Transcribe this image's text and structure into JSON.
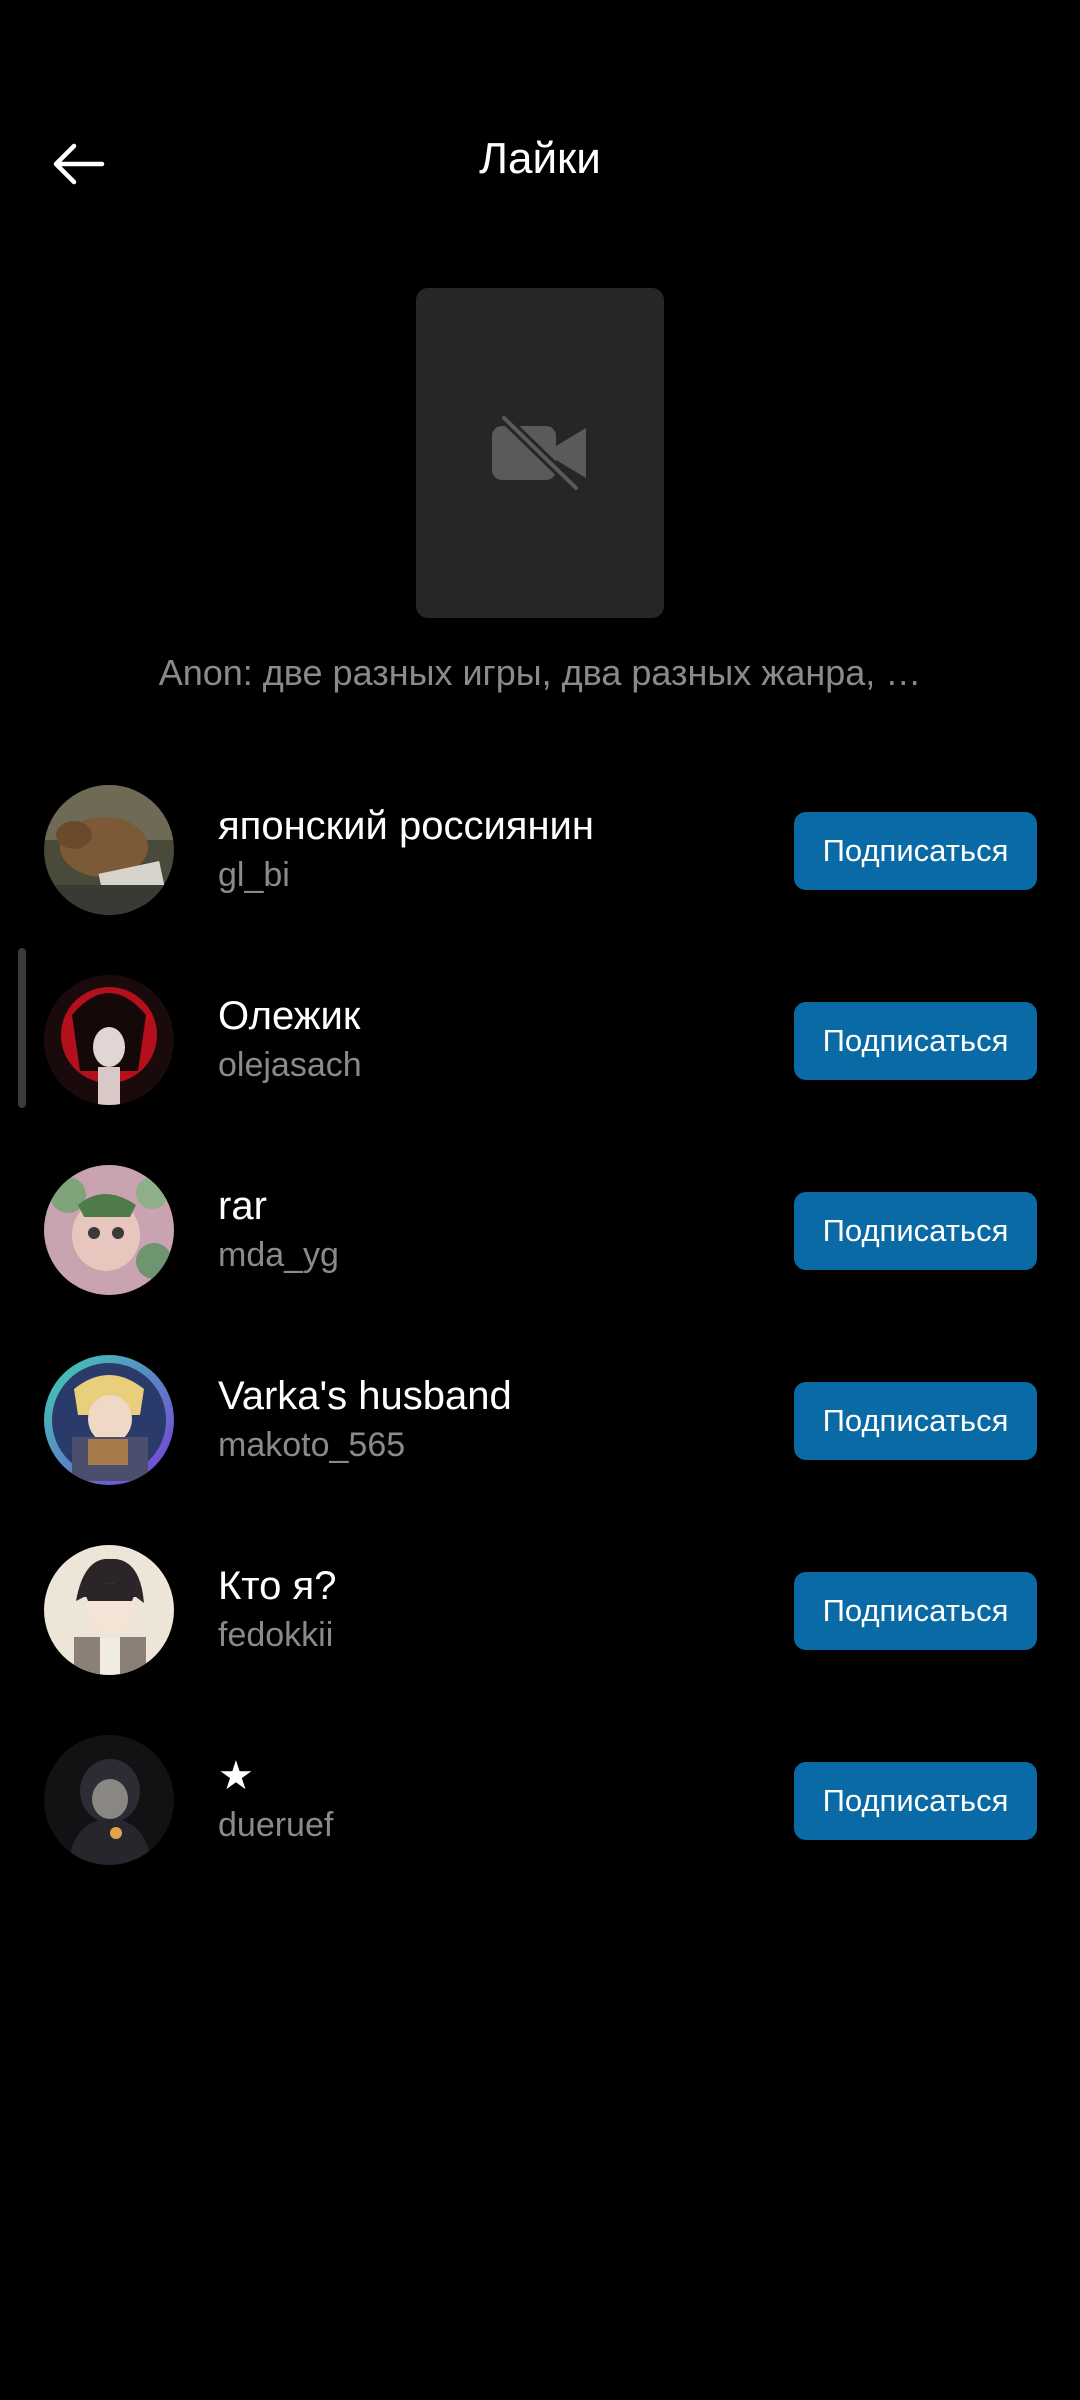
{
  "header": {
    "title": "Лайки",
    "back_icon": "arrow-left-icon"
  },
  "post": {
    "thumbnail_icon": "video-off-icon",
    "caption": "Anon: две разных игры, два разных жанра, …"
  },
  "colors": {
    "background": "#000000",
    "follow_button": "#0a6aa6",
    "secondary_text": "#8a8a8a",
    "thumbnail_bg": "#262626"
  },
  "likes": [
    {
      "display_name": "японский россиянин",
      "username": "gl_bi",
      "button_label": "Подписаться"
    },
    {
      "display_name": "Олежик",
      "username": "olejasach",
      "button_label": "Подписаться"
    },
    {
      "display_name": "rar",
      "username": "mda_yg",
      "button_label": "Подписаться"
    },
    {
      "display_name": "Varka's husband",
      "username": "makoto_565",
      "button_label": "Подписаться"
    },
    {
      "display_name": "Кто я?",
      "username": "fedokkii",
      "button_label": "Подписаться"
    },
    {
      "display_name": "★",
      "username": "dueruef",
      "button_label": "Подписаться"
    }
  ]
}
